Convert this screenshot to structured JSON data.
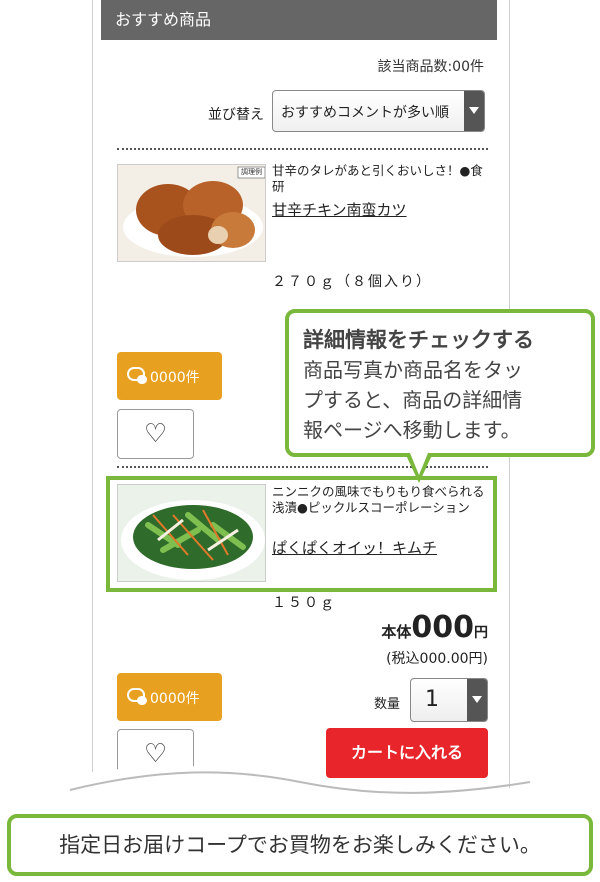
{
  "section": {
    "title": "おすすめ商品"
  },
  "result_count": "該当商品数:00件",
  "sort": {
    "label": "並び替え",
    "selected": "おすすめコメントが多い順"
  },
  "products": [
    {
      "catch": "甘辛のタレがあと引くおいしさ！●食研",
      "name": "甘辛チキン南蛮カツ",
      "spec": "２７０ｇ（８個入り）",
      "badge": "調理例",
      "review_label": "0000件"
    },
    {
      "catch": "ニンニクの風味でもりもり食べられる浅漬●ピックルスコーポレーション",
      "name": "ぱくぱくオイッ！キムチ",
      "spec": "１５０ｇ",
      "price_prefix": "本体",
      "price": "000",
      "price_unit": "円",
      "tax_price": "(税込000.00円)",
      "review_label": "0000件"
    }
  ],
  "quantity": {
    "label": "数量",
    "value": "1"
  },
  "cart_button": "カートに入れる",
  "callout": {
    "title": "詳細情報をチェックする",
    "lines": [
      "商品写真か商品名をタッ",
      "プすると、商品の詳細情",
      "報ページへ移動します。"
    ]
  },
  "banner": "指定日お届けコープでお買物をお楽しみください。",
  "colors": {
    "accent_green": "#7ab83c",
    "review_orange": "#e8a020",
    "cart_red": "#e8252b",
    "header_gray": "#666666"
  }
}
